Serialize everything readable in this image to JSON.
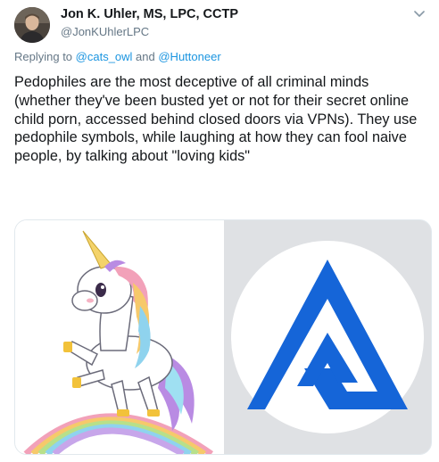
{
  "author": {
    "name": "Jon K. Uhler, MS, LPC, CCTP",
    "handle": "@JonKUhlerLPC"
  },
  "reply": {
    "prefix": "Replying to ",
    "user1": "@cats_owl",
    "conjunction": " and ",
    "user2": "@Huttoneer"
  },
  "tweet": {
    "text": "Pedophiles are the most deceptive of all criminal minds (whether they've been busted yet or not for their secret online child porn, accessed behind closed doors via VPNs). They use pedophile symbols, while laughing at how they can fool naive people, by talking about \"loving kids\""
  },
  "media": {
    "left_image": "unicorn-illustration",
    "right_image": "blue-spiral-triangle-symbol"
  },
  "colors": {
    "link": "#1b95e0",
    "secondary_text": "#657786",
    "symbol_blue": "#1565d8"
  }
}
